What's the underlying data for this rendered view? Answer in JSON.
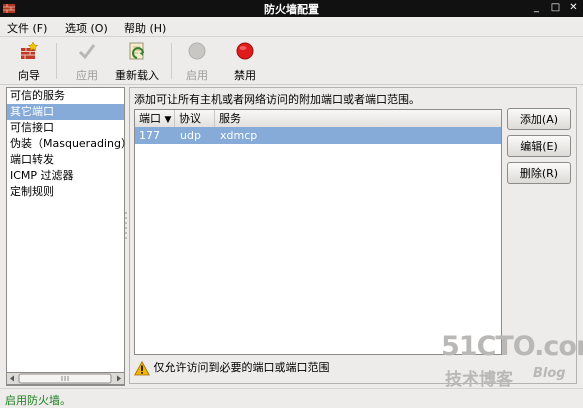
{
  "window": {
    "title": "防火墙配置"
  },
  "menubar": [
    "文件 (F)",
    "选项 (O)",
    "帮助 (H)"
  ],
  "toolbar": {
    "wizard": "向导",
    "apply": "应用",
    "reload": "重新载入",
    "enable": "启用",
    "disable": "禁用"
  },
  "sidebar": {
    "items": [
      "可信的服务",
      "其它端口",
      "可信接口",
      "伪装（Masquerading）",
      "端口转发",
      "ICMP 过滤器",
      "定制规则"
    ],
    "selected": "其它端口"
  },
  "main": {
    "description": "添加可让所有主机或者网络访问的附加端口或者端口范围。",
    "columns": {
      "port": "端口",
      "protocol": "协议",
      "service": "服务"
    },
    "rows": [
      {
        "port": "177",
        "protocol": "udp",
        "service": "xdmcp"
      }
    ],
    "buttons": {
      "add": "添加(A)",
      "edit": "编辑(E)",
      "remove": "删除(R)"
    },
    "warning": "仅允许访问到必要的端口或端口范围"
  },
  "status": "启用防火墙。",
  "watermark": {
    "site": "51CTO.com",
    "tagline": "技术博客",
    "blog": "Blog"
  },
  "colors": {
    "selection": "#86abd9",
    "status_text": "#1d7f1d",
    "titlebar": "#111111"
  }
}
